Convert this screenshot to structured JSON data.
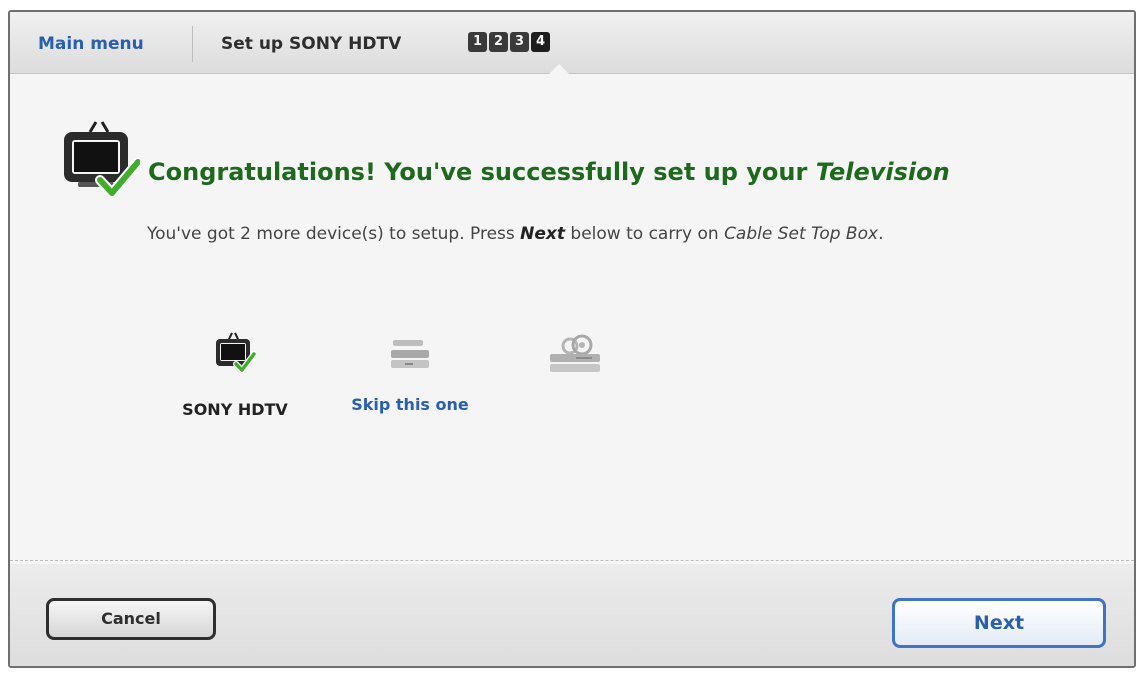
{
  "header": {
    "main_menu": "Main menu",
    "title": "Set up SONY HDTV",
    "steps": [
      "1",
      "2",
      "3",
      "4"
    ],
    "active_step": 4
  },
  "content": {
    "congrats_prefix": "Congratulations! You've successfully set up your ",
    "congrats_device": "Television",
    "sub_prefix": "You've got 2 more device(s) to setup. Press ",
    "sub_next": "Next",
    "sub_middle": " below to carry on ",
    "sub_device": "Cable Set Top Box",
    "sub_suffix": "."
  },
  "devices": [
    {
      "label": "SONY HDTV",
      "icon": "tv-check-icon",
      "state": "done"
    },
    {
      "label": "Skip this one",
      "icon": "set-top-box-icon",
      "state": "current"
    },
    {
      "label": "",
      "icon": "dvd-player-icon",
      "state": "pending"
    }
  ],
  "footer": {
    "cancel_label": "Cancel",
    "next_label": "Next"
  },
  "colors": {
    "accent_blue": "#2a5fae",
    "success_green": "#1d6a1d",
    "check_green": "#3fae2a"
  }
}
